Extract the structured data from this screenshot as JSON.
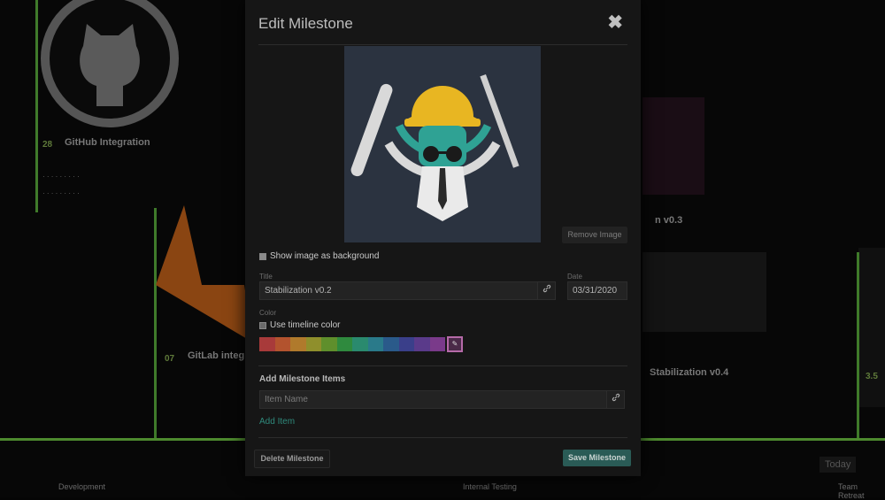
{
  "background": {
    "github_label": "GitHub Integration",
    "github_num": "28",
    "gitlab_label": "GitLab integ",
    "gitlab_num": "07",
    "ms3_label": "n v0.3",
    "ms4_label": "Stabilization v0.4",
    "right_num": "3.5",
    "today": "Today",
    "footer": [
      "Development",
      "Internal Testing",
      "Team Retreat"
    ]
  },
  "modal": {
    "title": "Edit Milestone",
    "close": "✖",
    "remove_image": "Remove Image",
    "show_bg_label": "Show image as background",
    "title_label": "Title",
    "title_value": "Stabilization v0.2",
    "date_label": "Date",
    "date_value": "03/31/2020",
    "color_label": "Color",
    "use_timeline_label": "Use timeline color",
    "swatches": [
      "#a83a3a",
      "#b3532e",
      "#b07a2c",
      "#8f8f2c",
      "#5f8f2c",
      "#2f8a3e",
      "#2a8a6e",
      "#2a7a8a",
      "#2a5a8a",
      "#3a3f8a",
      "#5a3a8a",
      "#7a3a8a"
    ],
    "add_items_title": "Add Milestone Items",
    "item_placeholder": "Item Name",
    "add_item": "Add Item",
    "delete_button": "Delete Milestone",
    "save_button": "Save Milestone",
    "icons": {
      "close": "close-icon",
      "link": "link-icon",
      "eyedropper": "eyedropper-icon"
    }
  }
}
